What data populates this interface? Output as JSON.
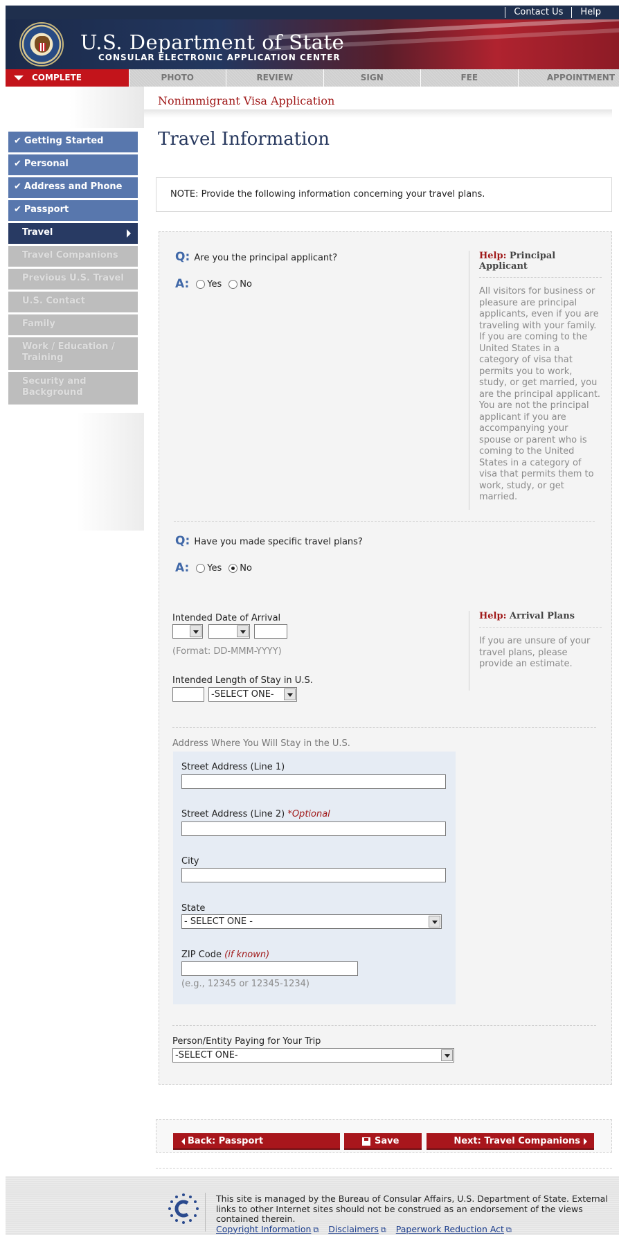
{
  "header": {
    "links": [
      "Contact Us",
      "Help"
    ],
    "title_main": "U.S. Department of State",
    "title_sub": "CONSULAR ELECTRONIC APPLICATION CENTER"
  },
  "steps": [
    "COMPLETE",
    "PHOTO",
    "REVIEW",
    "SIGN",
    "FEE",
    "APPOINTMENT"
  ],
  "sidebar": {
    "done": [
      "Getting Started",
      "Personal",
      "Address and Phone",
      "Passport"
    ],
    "current": "Travel",
    "todo": [
      "Travel Companions",
      "Previous U.S. Travel",
      "U.S. Contact",
      "Family",
      "Work / Education / Training",
      "Security and Background"
    ]
  },
  "main": {
    "app_title": "Nonimmigrant Visa Application",
    "page_title": "Travel Information",
    "note": "NOTE: Provide the following information concerning your travel plans."
  },
  "q1": {
    "q_label": "Q:",
    "a_label": "A:",
    "question": "Are you the principal applicant?",
    "yes": "Yes",
    "no": "No",
    "selected": "none"
  },
  "help1": {
    "prefix": "Help:",
    "title": "Principal Applicant",
    "body": "All visitors for business or pleasure are principal applicants, even if you are traveling with your family. If you are coming to the United States in a category of visa that permits you to work, study, or get married, you are the principal applicant. You are not the principal applicant if you are accompanying your spouse or parent who is coming to the United States in a category of visa that permits them to work, study, or get married."
  },
  "q2": {
    "q_label": "Q:",
    "a_label": "A:",
    "question": "Have you made specific travel plans?",
    "yes": "Yes",
    "no": "No",
    "selected": "No"
  },
  "arrival": {
    "label": "Intended Date of Arrival",
    "format": "(Format: DD-MMM-YYYY)",
    "stay_label": "Intended Length of Stay in U.S.",
    "stay_unit": "-SELECT ONE-"
  },
  "help2": {
    "prefix": "Help:",
    "title": "Arrival Plans",
    "body": "If you are unsure of your travel plans, please provide an estimate."
  },
  "address": {
    "section": "Address Where You Will Stay in the U.S.",
    "street1": "Street Address (Line 1)",
    "street2": "Street Address (Line 2)",
    "optional": "*Optional",
    "city": "City",
    "state": "State",
    "state_value": "- SELECT ONE -",
    "zip": "ZIP Code",
    "zip_note": "(if known)",
    "zip_example": "(e.g., 12345 or 12345-1234)"
  },
  "payer": {
    "label": "Person/Entity Paying for Your Trip",
    "value": "-SELECT ONE-"
  },
  "actions": {
    "back": "Back: Passport",
    "save": "Save",
    "next": "Next: Travel Companions"
  },
  "footer": {
    "text": "This site is managed by the Bureau of Consular Affairs, U.S. Department of State. External links to other Internet sites should not be construed as an endorsement of the views contained therein.",
    "links": [
      "Copyright Information",
      "Disclaimers",
      "Paperwork Reduction Act"
    ]
  },
  "colors": {
    "nav_done": "#5877ad",
    "nav_current": "#283a63",
    "accent_red": "#a8161c",
    "title_blue": "#27385e"
  }
}
